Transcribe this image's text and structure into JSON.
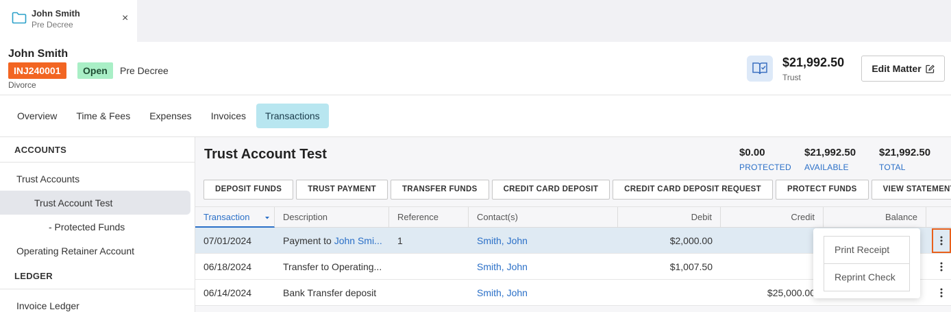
{
  "doc_tab": {
    "title": "John Smith",
    "subtitle": "Pre Decree",
    "close": "×"
  },
  "matter": {
    "client_name": "John Smith",
    "matter_id": "INJ240001",
    "status": "Open",
    "stage": "Pre Decree",
    "type": "Divorce",
    "trust_amount": "$21,992.50",
    "trust_label": "Trust",
    "edit_label": "Edit Matter"
  },
  "nav_tabs": [
    {
      "label": "Overview",
      "active": false
    },
    {
      "label": "Time & Fees",
      "active": false
    },
    {
      "label": "Expenses",
      "active": false
    },
    {
      "label": "Invoices",
      "active": false
    },
    {
      "label": "Transactions",
      "active": true
    }
  ],
  "sidebar": {
    "accounts_heading": "ACCOUNTS",
    "trust_accounts": "Trust Accounts",
    "trust_account_test": "Trust Account Test",
    "protected_funds": "- Protected Funds",
    "operating_retainer": "Operating Retainer Account",
    "ledger_heading": "LEDGER",
    "invoice_ledger": "Invoice Ledger"
  },
  "account": {
    "title": "Trust Account Test",
    "protected": {
      "value": "$0.00",
      "label": "PROTECTED"
    },
    "available": {
      "value": "$21,992.50",
      "label": "AVAILABLE"
    },
    "total": {
      "value": "$21,992.50",
      "label": "TOTAL"
    }
  },
  "actions": [
    "DEPOSIT FUNDS",
    "TRUST PAYMENT",
    "TRANSFER FUNDS",
    "CREDIT CARD DEPOSIT",
    "CREDIT CARD DEPOSIT REQUEST",
    "PROTECT FUNDS",
    "VIEW STATEMENT"
  ],
  "table": {
    "headers": {
      "transaction": "Transaction",
      "description": "Description",
      "reference": "Reference",
      "contacts": "Contact(s)",
      "debit": "Debit",
      "credit": "Credit",
      "balance": "Balance"
    },
    "rows": [
      {
        "date": "07/01/2024",
        "desc_prefix": "Payment to ",
        "desc_link": "John Smi...",
        "reference": "1",
        "contact": "Smith, John",
        "debit": "$2,000.00",
        "credit": "",
        "balance": ""
      },
      {
        "date": "06/18/2024",
        "desc_prefix": "Transfer to Operating...",
        "desc_link": "",
        "reference": "",
        "contact": "Smith, John",
        "debit": "$1,007.50",
        "credit": "",
        "balance": ""
      },
      {
        "date": "06/14/2024",
        "desc_prefix": "Bank Transfer deposit",
        "desc_link": "",
        "reference": "",
        "contact": "Smith, John",
        "debit": "",
        "credit": "$25,000.00",
        "balance": ""
      }
    ]
  },
  "row_menu": {
    "print_receipt": "Print Receipt",
    "reprint_check": "Reprint Check"
  },
  "colors": {
    "accent": "#2a6fc7",
    "matter_id_bg": "#f26522",
    "open_bg": "#a9efc6",
    "active_tab_bg": "#b8e6f0",
    "focus_outline": "#e8601c"
  }
}
